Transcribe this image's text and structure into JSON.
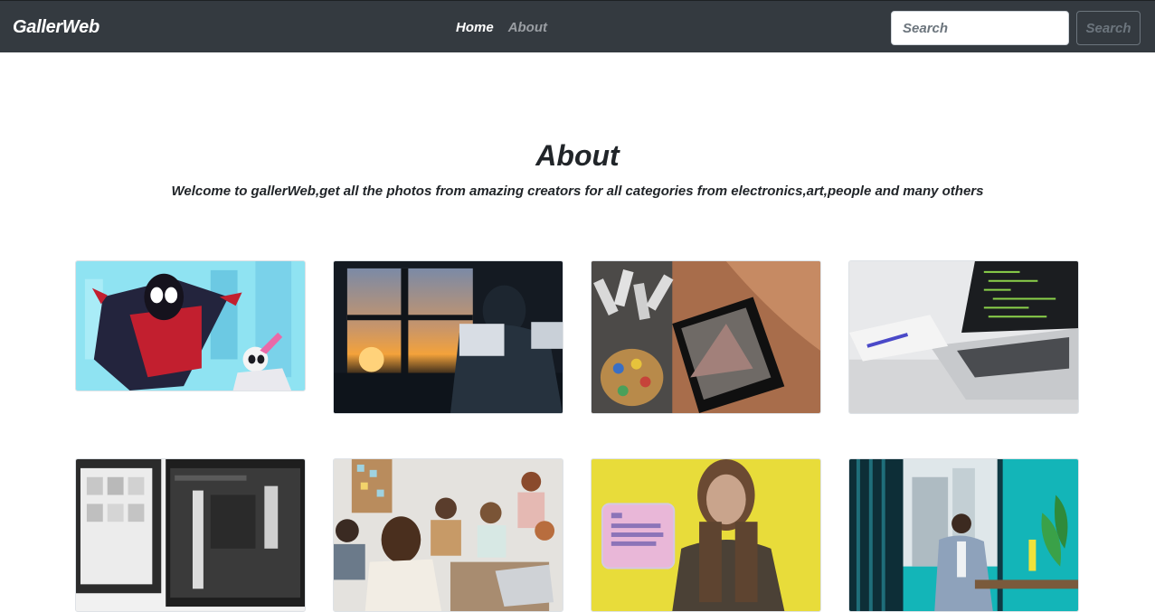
{
  "navbar": {
    "brand": "GallerWeb",
    "links": [
      {
        "label": "Home",
        "active": true
      },
      {
        "label": "About",
        "active": false
      }
    ],
    "search": {
      "placeholder": "Search",
      "value": "",
      "button_label": "Search"
    }
  },
  "header": {
    "title": "About",
    "subtitle": "Welcome to gallerWeb,get all the photos from amazing creators for all categories from electronics,art,people and many others"
  },
  "gallery": {
    "images": [
      {
        "subject": "animated spider hero swinging in a city"
      },
      {
        "subject": "person with headphones at computer by sunset window"
      },
      {
        "subject": "paint tubes, palette and mountain painting on bed"
      },
      {
        "subject": "laptop with code and notebook with pen"
      },
      {
        "subject": "monitor with photo editing app on desk"
      },
      {
        "subject": "team meeting around a table with laptops"
      },
      {
        "subject": "woman holding a pink note in front of yellow wall"
      },
      {
        "subject": "businessman working at desk by window"
      }
    ]
  },
  "colors": {
    "navbar_bg": "#343a40",
    "active_link": "#ffffff",
    "inactive_link": "#9a9ea3",
    "outline_button": "#6c757d"
  }
}
